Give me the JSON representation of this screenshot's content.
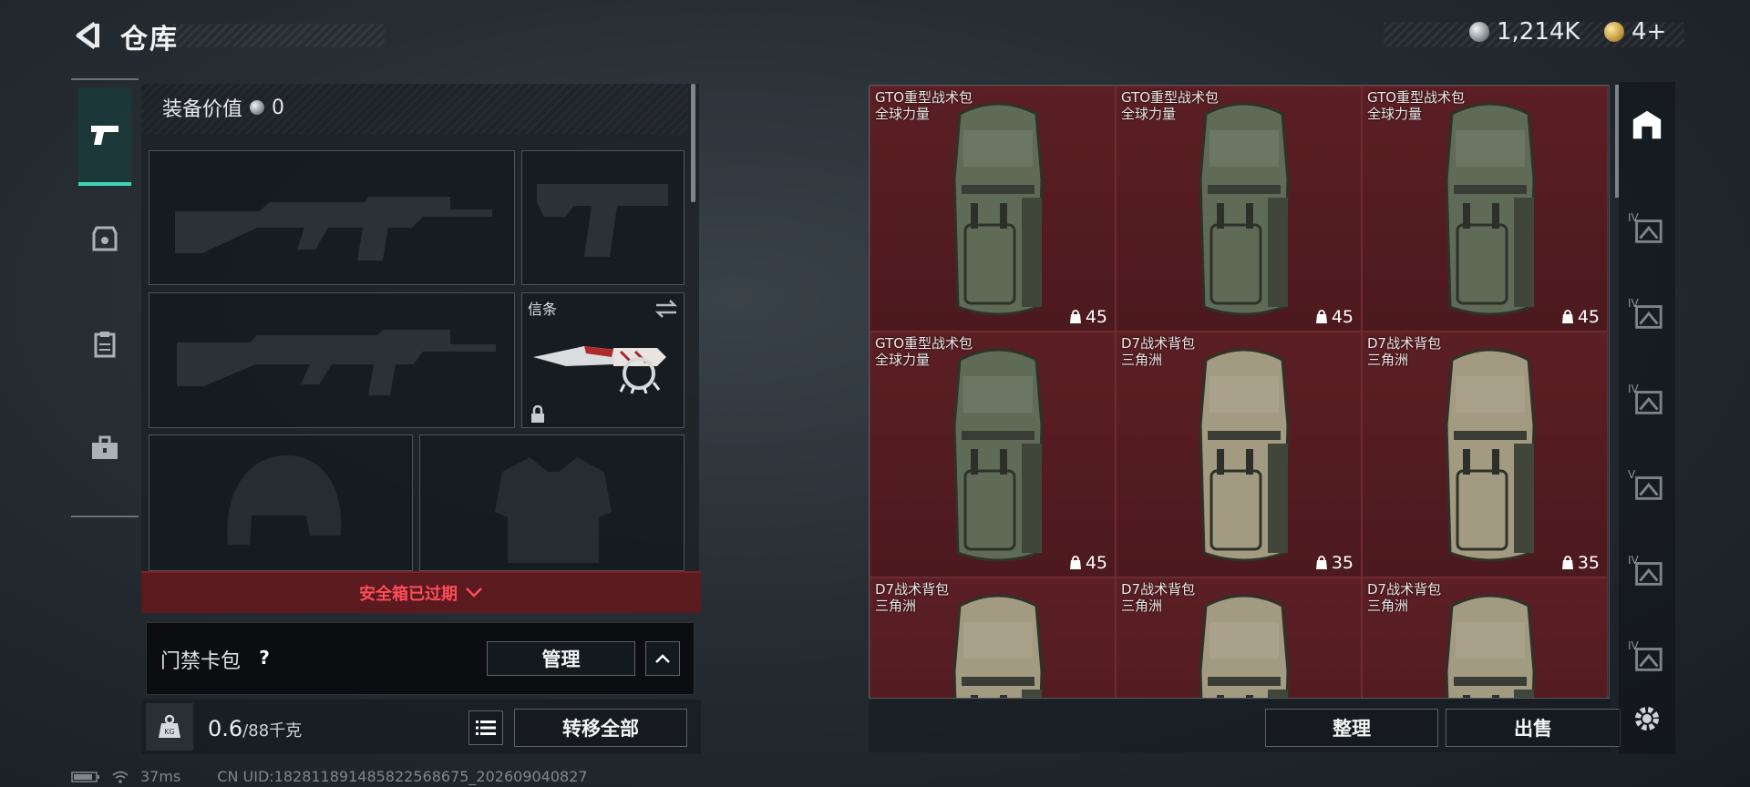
{
  "header": {
    "title": "仓库",
    "silver_amount": "1,214K",
    "gold_amount": "4+"
  },
  "left_nav": {
    "items": [
      "pistol-icon",
      "armor-icon",
      "rig-icon",
      "toolbox-icon"
    ]
  },
  "equipment": {
    "value_label": "装备价值",
    "value": "0",
    "slots": {
      "melee_label": "信条"
    },
    "safebox_status": "安全箱已过期"
  },
  "card_pack": {
    "label": "门禁卡包",
    "help": "?",
    "manage_label": "管理"
  },
  "capacity": {
    "current": "0.6",
    "max": "/88千克",
    "transfer_all_label": "转移全部"
  },
  "status_bar": {
    "ping": "37ms",
    "uid": "CN UID:18281189148582256867​5_202609040827"
  },
  "stash": {
    "items": [
      {
        "name": "GTO重型战术包",
        "sub": "全球力量",
        "count": "45",
        "color": "#5f6b57"
      },
      {
        "name": "GTO重型战术包",
        "sub": "全球力量",
        "count": "45",
        "color": "#5f6b57"
      },
      {
        "name": "GTO重型战术包",
        "sub": "全球力量",
        "count": "45",
        "color": "#5f6b57"
      },
      {
        "name": "GTO重型战术包",
        "sub": "全球力量",
        "count": "45",
        "color": "#5f6b57"
      },
      {
        "name": "D7战术背包",
        "sub": "三角洲",
        "count": "35",
        "color": "#a39a82"
      },
      {
        "name": "D7战术背包",
        "sub": "三角洲",
        "count": "35",
        "color": "#a39a82"
      },
      {
        "name": "D7战术背包",
        "sub": "三角洲",
        "count": "",
        "color": "#a39a82"
      },
      {
        "name": "D7战术背包",
        "sub": "三角洲",
        "count": "",
        "color": "#a39a82"
      },
      {
        "name": "D7战术背包",
        "sub": "三角洲",
        "count": "",
        "color": "#a39a82"
      }
    ],
    "sort_label": "整理",
    "sell_label": "出售"
  },
  "right_nav": {
    "items": [
      "IV",
      "IV",
      "IV",
      "V",
      "IV",
      "IV"
    ]
  }
}
